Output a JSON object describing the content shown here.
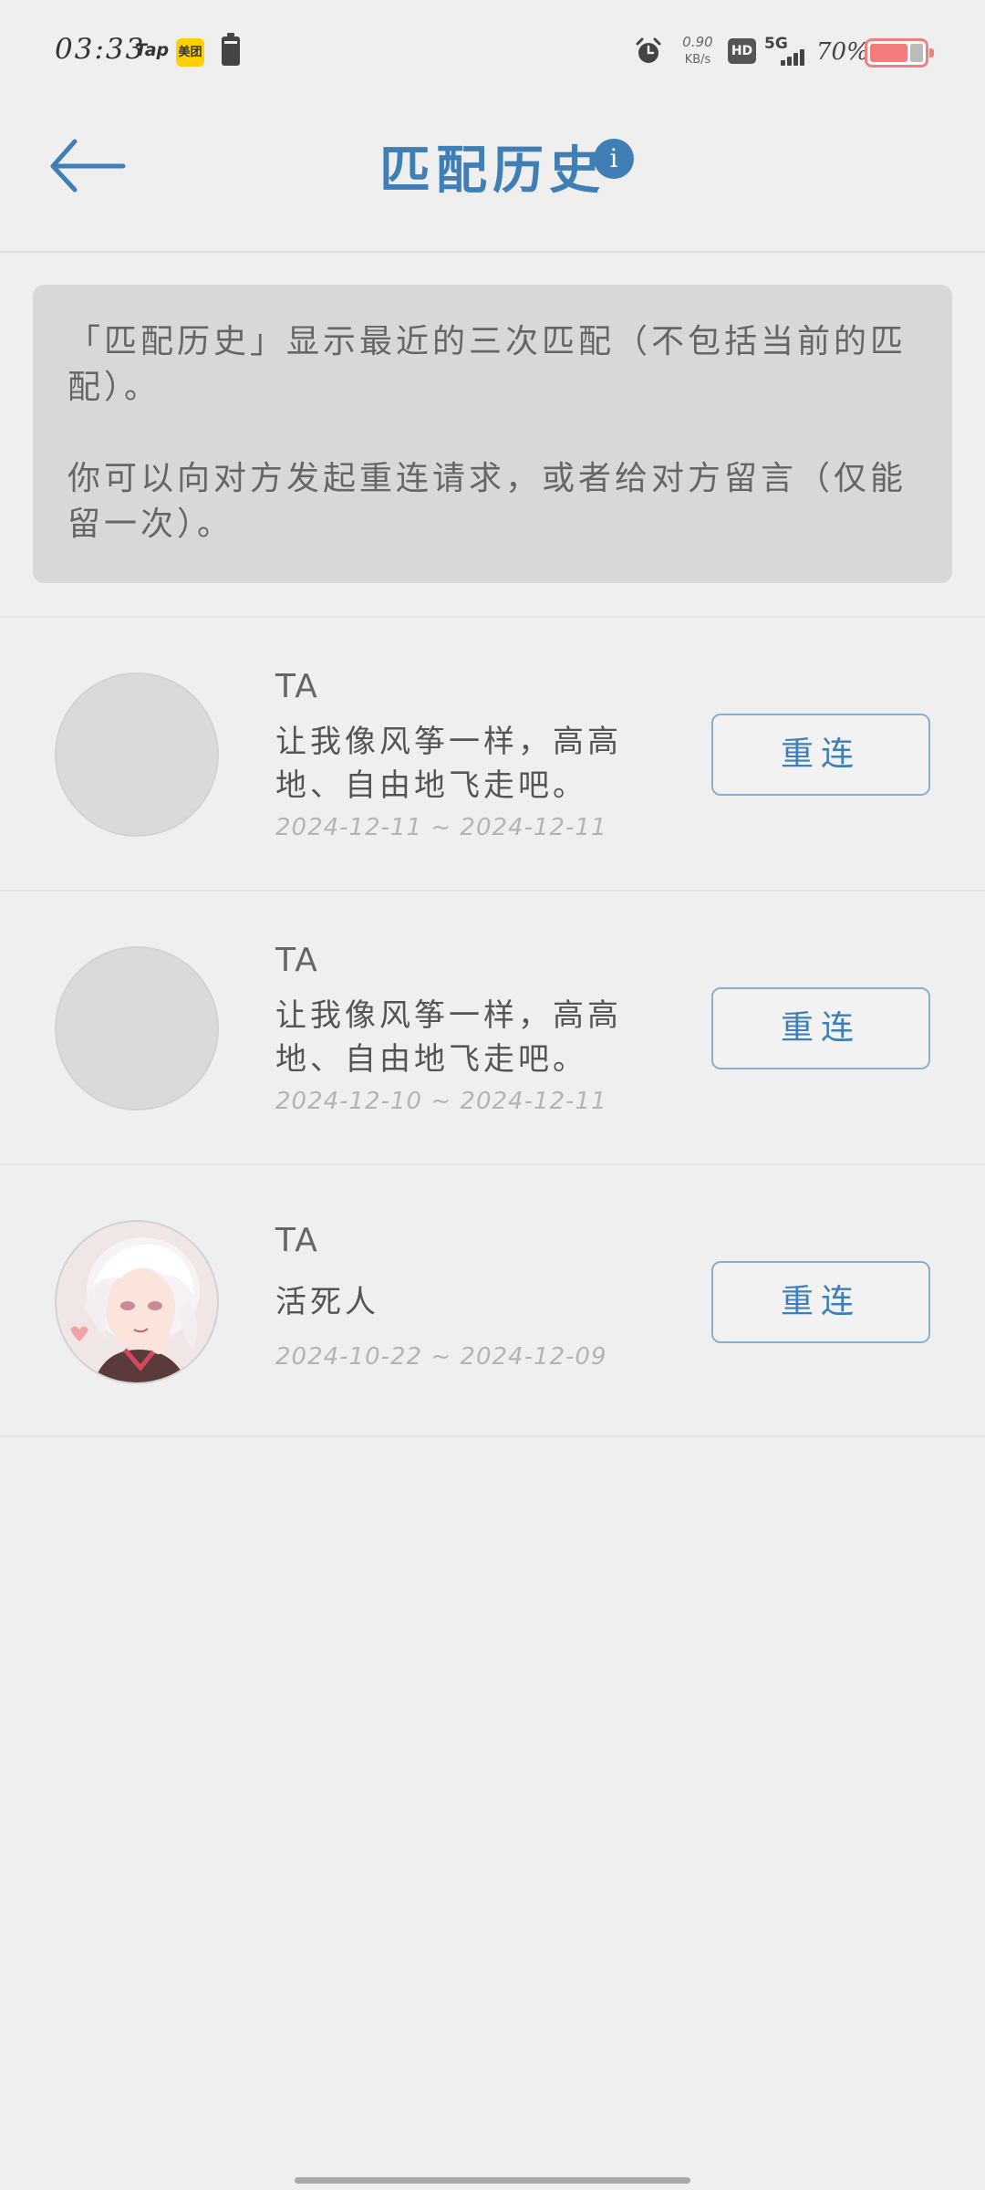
{
  "status_bar": {
    "time": "03:33",
    "tap_label": "Tap",
    "meituan_label": "美团",
    "speed_value": "0.90",
    "speed_unit": "KB/s",
    "hd_label": "HD",
    "network": "5G",
    "battery_percent": "70%",
    "battery_level": 0.7,
    "icons": [
      "tap-app-icon",
      "meituan-app-icon",
      "battery-saver-icon",
      "alarm-icon",
      "hd-icon",
      "signal-icon",
      "battery-icon"
    ]
  },
  "header": {
    "title": "匹配历史",
    "back_icon": "arrow-left-icon",
    "info_label": "i"
  },
  "notice": {
    "line1": "「匹配历史」显示最近的三次匹配（不包括当前的匹配）。",
    "line2": "你可以向对方发起重连请求，或者给对方留言（仅能留一次）。"
  },
  "matches": [
    {
      "name": "TA",
      "message": "让我像风筝一样，高高地、自由地飞走吧。",
      "date": "2024-12-11 ~ 2024-12-11",
      "button": "重连",
      "avatar": "placeholder"
    },
    {
      "name": "TA",
      "message": "让我像风筝一样，高高地、自由地飞走吧。",
      "date": "2024-12-10 ~ 2024-12-11",
      "button": "重连",
      "avatar": "placeholder"
    },
    {
      "name": "TA",
      "message": "活死人",
      "date": "2024-10-22 ~ 2024-12-09",
      "button": "重连",
      "avatar": "anime-portrait"
    }
  ],
  "colors": {
    "accent": "#3f7fb5",
    "background": "#efefef",
    "notice_bg": "#d8d8d8",
    "battery": "#f47b7b"
  }
}
